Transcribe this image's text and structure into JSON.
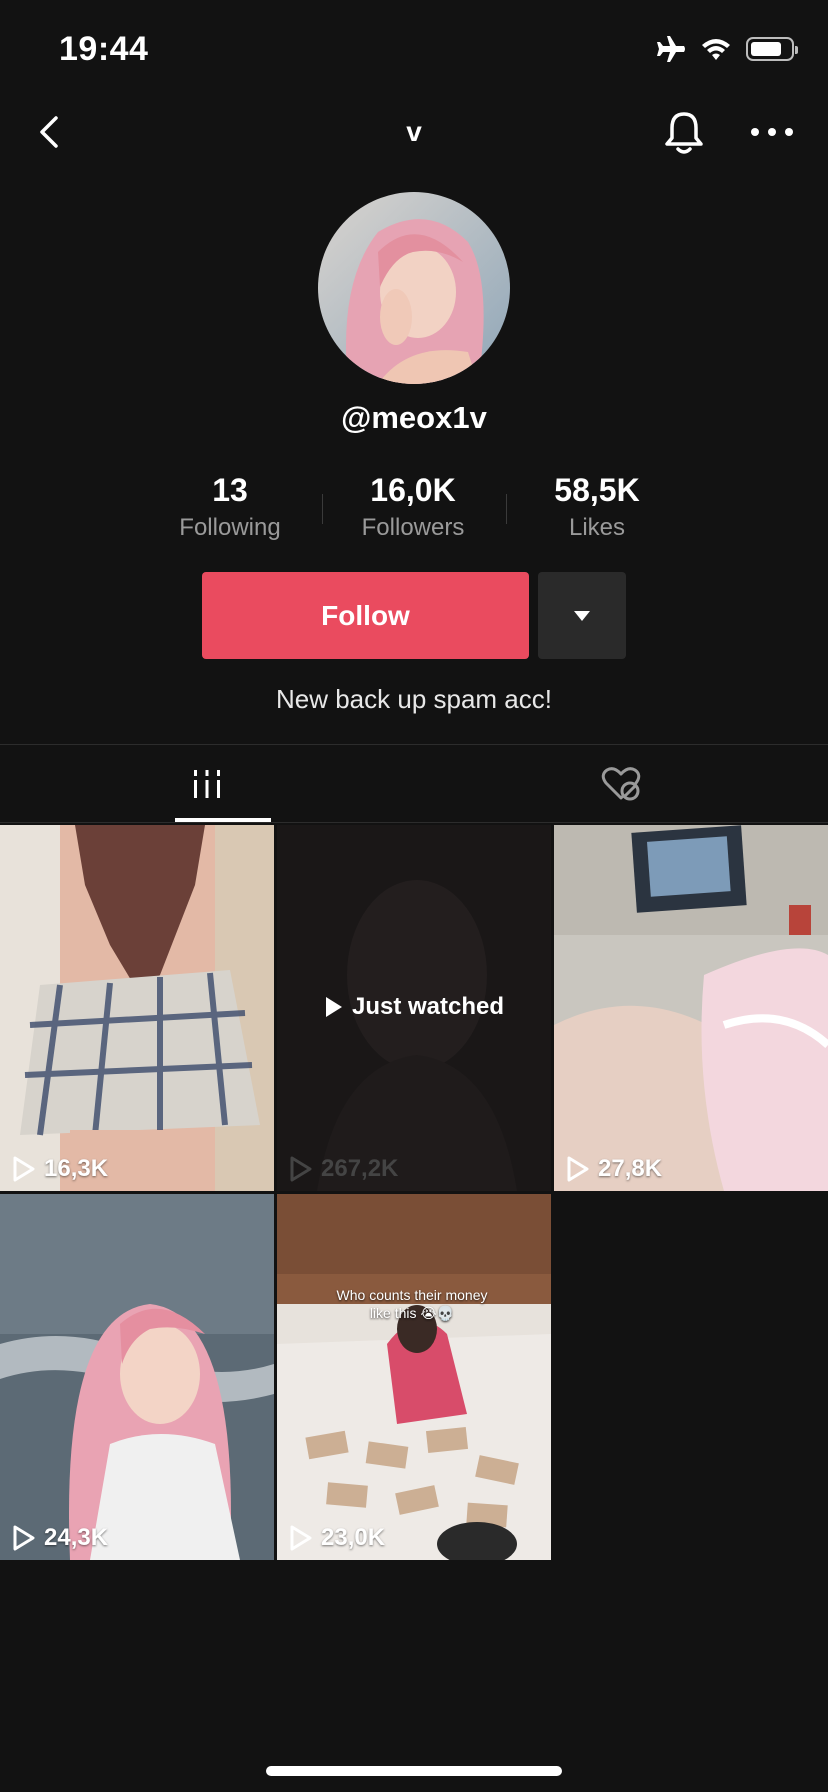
{
  "status_bar": {
    "time": "19:44",
    "battery_level": 0.75
  },
  "nav": {
    "title": "v"
  },
  "profile": {
    "handle": "@meox1v",
    "bio": "New back up spam acc!"
  },
  "stats": [
    {
      "value": "13",
      "label": "Following"
    },
    {
      "value": "16,0K",
      "label": "Followers"
    },
    {
      "value": "58,5K",
      "label": "Likes"
    }
  ],
  "actions": {
    "follow_label": "Follow"
  },
  "videos": [
    {
      "views": "16,3K"
    },
    {
      "views": "267,2K",
      "overlay": "Just watched"
    },
    {
      "views": "27,8K"
    },
    {
      "views": "24,3K"
    },
    {
      "views": "23,0K",
      "caption_line1": "Who counts their money",
      "caption_line2": "like this 😭💀"
    }
  ],
  "colors": {
    "background": "#121212",
    "follow": "#ea4b5f",
    "secondary_button": "#2a2a2a"
  }
}
